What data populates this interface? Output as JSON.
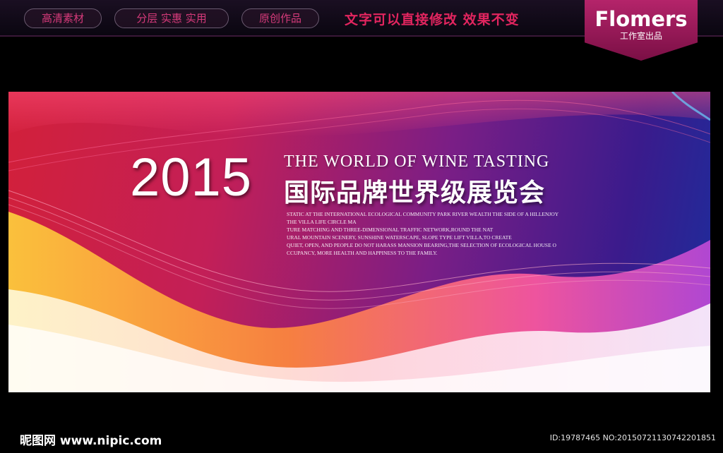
{
  "header": {
    "pills": [
      "高清素材",
      "分层 实惠 实用",
      "原创作品"
    ],
    "tagline": "文字可以直接修改  效果不变",
    "brand_name": "Flomers",
    "brand_sub": "工作室出品"
  },
  "banner": {
    "year": "2015",
    "english_title": "THE WORLD OF WINE TASTING",
    "chinese_title": "国际品牌世界级展览会",
    "paragraph_lines": [
      "STATIC AT THE INTERNATIONAL ECOLOGICAL COMMUNITY PARK RIVER WEALTH THE SIDE OF A HILLENJOY",
      "THE VILLA LIFE CIRCLE MA",
      "TURE MATCHING AND THREE-DIMENSIONAL TRAFFIC NETWORK,ROUND THE NAT",
      "URAL MOUNTAIN SCENERY, SUNSHINE WATERSCAPE, SLOPE TYPE LIFT VILLA,TO CREATE",
      "QUIET, OPEN, AND PEOPLE DO NOT HARASS MANSION BEARING,THE SELECTION OF ECOLOGICAL HOUSE O",
      "CCUPANCY, MORE HEALTH AND HAPPINESS TO THE FAMILY."
    ]
  },
  "footer": {
    "site": "昵图网 www.nipic.com",
    "id_text": "ID:19787465 NO:20150721130742201851"
  }
}
